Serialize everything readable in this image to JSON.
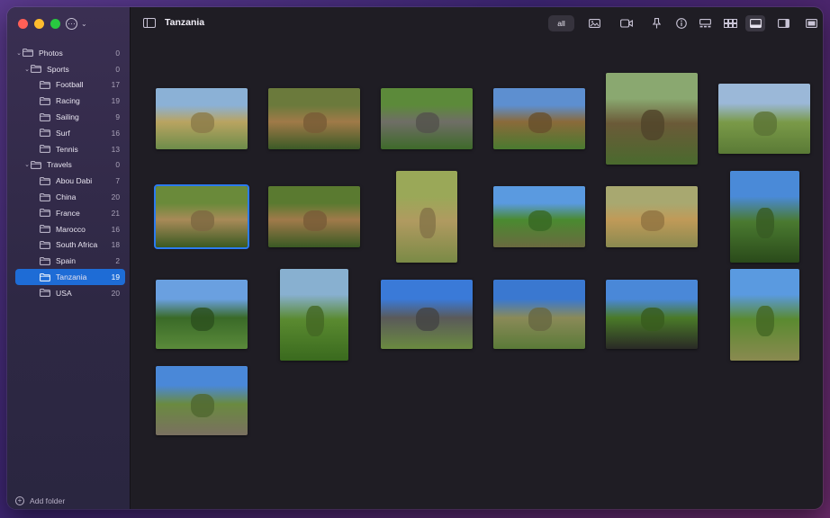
{
  "window": {
    "title": "Tanzania"
  },
  "sidebar": {
    "tree": [
      {
        "label": "Photos",
        "count": "0",
        "level": 0,
        "expanded": true
      },
      {
        "label": "Sports",
        "count": "0",
        "level": 1,
        "expanded": true
      },
      {
        "label": "Football",
        "count": "17",
        "level": 2
      },
      {
        "label": "Racing",
        "count": "19",
        "level": 2
      },
      {
        "label": "Sailing",
        "count": "9",
        "level": 2
      },
      {
        "label": "Surf",
        "count": "16",
        "level": 2
      },
      {
        "label": "Tennis",
        "count": "13",
        "level": 2
      },
      {
        "label": "Travels",
        "count": "0",
        "level": 1,
        "expanded": true
      },
      {
        "label": "Abou Dabi",
        "count": "7",
        "level": 2
      },
      {
        "label": "China",
        "count": "20",
        "level": 2
      },
      {
        "label": "France",
        "count": "21",
        "level": 2
      },
      {
        "label": "Marocco",
        "count": "16",
        "level": 2
      },
      {
        "label": "South Africa",
        "count": "18",
        "level": 2
      },
      {
        "label": "Spain",
        "count": "2",
        "level": 2
      },
      {
        "label": "Tanzania",
        "count": "19",
        "level": 2,
        "selected": true
      },
      {
        "label": "USA",
        "count": "20",
        "level": 2
      }
    ],
    "add_folder_label": "Add folder"
  },
  "toolbar": {
    "filter_all_label": "all",
    "icons": [
      "photo-filter-icon",
      "video-filter-icon",
      "pin-icon",
      "info-icon",
      "filmstrip-view-icon",
      "grid-view-icon",
      "single-view-icon",
      "inspector-toggle-icon",
      "fullscreen-icon"
    ]
  },
  "photos": [
    {
      "name": "giraffes-plain",
      "palette": [
        "#8bb1d6",
        "#b9a461",
        "#6d8c4a"
      ]
    },
    {
      "name": "lion-resting",
      "palette": [
        "#6b7a3c",
        "#a07a48",
        "#3b5a26"
      ]
    },
    {
      "name": "elephant-bush",
      "palette": [
        "#5c8a3a",
        "#6f6e66",
        "#3e6a2a"
      ]
    },
    {
      "name": "giraffe-acacia",
      "palette": [
        "#5d8fd0",
        "#8a6a3a",
        "#4a7a30"
      ]
    },
    {
      "name": "leopard-tree",
      "palette": [
        "#8aa870",
        "#6b5a38",
        "#4a6a2e"
      ]
    },
    {
      "name": "buffalo-plain",
      "palette": [
        "#9bb8d8",
        "#7a9a48",
        "#5a7a36"
      ]
    },
    {
      "name": "lionesses-cubs",
      "palette": [
        "#6a8a3a",
        "#a88a58",
        "#3a5a22"
      ],
      "selected": true
    },
    {
      "name": "lions-tree",
      "palette": [
        "#5a7a30",
        "#a07a4a",
        "#3a5a24"
      ]
    },
    {
      "name": "cheetah-grass",
      "palette": [
        "#9aa858",
        "#b09a60",
        "#7a8a46"
      ]
    },
    {
      "name": "bird-bush",
      "palette": [
        "#5a9ae0",
        "#4a8a30",
        "#6a6a40"
      ]
    },
    {
      "name": "cheetah-portrait",
      "palette": [
        "#a8a870",
        "#c09a58",
        "#8a8a50"
      ]
    },
    {
      "name": "acacia-sky-tall",
      "palette": [
        "#4a8ad8",
        "#4a7a30",
        "#2a4a1a"
      ]
    },
    {
      "name": "acacia-row",
      "palette": [
        "#6aa0e0",
        "#3a6a28",
        "#5a8a3a"
      ]
    },
    {
      "name": "green-valley",
      "palette": [
        "#88b0d0",
        "#5a8a30",
        "#3a6a1e"
      ]
    },
    {
      "name": "rock-sky",
      "palette": [
        "#3a7ad8",
        "#5a5a5a",
        "#6a8a40"
      ]
    },
    {
      "name": "savanna-clouds",
      "palette": [
        "#3a78d0",
        "#8a8a58",
        "#5a7a38"
      ]
    },
    {
      "name": "buffalo-grass",
      "palette": [
        "#4a88d8",
        "#4a7a28",
        "#2a2a26"
      ]
    },
    {
      "name": "lone-acacia",
      "palette": [
        "#5a9ae0",
        "#5a8a30",
        "#8a8a50"
      ]
    },
    {
      "name": "kopje-rocks",
      "palette": [
        "#4a88d8",
        "#6a8a40",
        "#7a7060"
      ]
    }
  ]
}
